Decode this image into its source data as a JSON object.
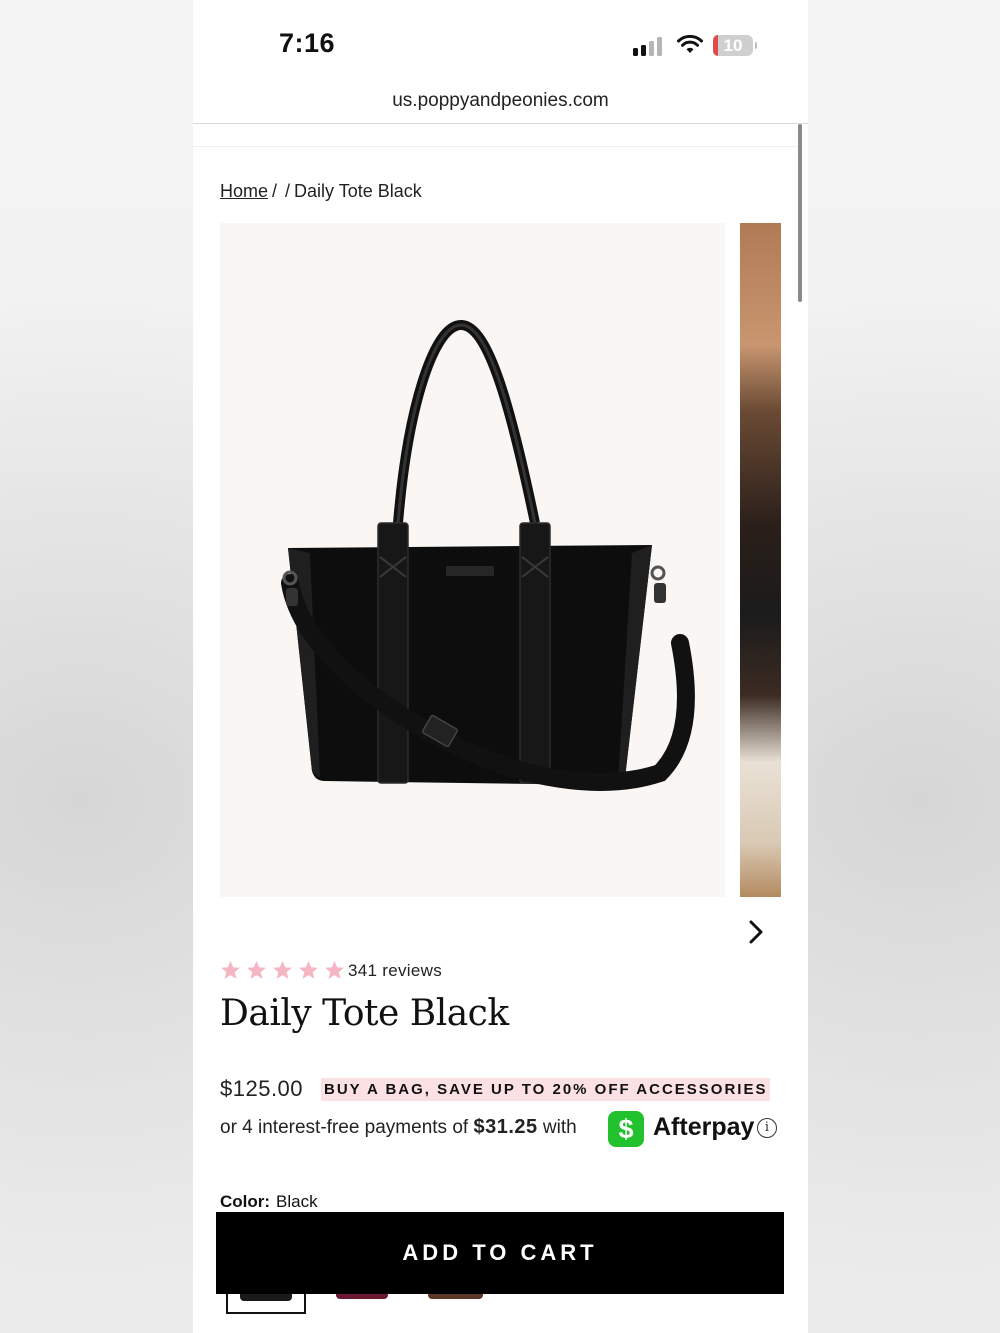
{
  "status_bar": {
    "time": "7:16",
    "battery": "10",
    "icons": [
      "signal-icon",
      "wifi-icon",
      "battery-icon"
    ]
  },
  "browser": {
    "url": "us.poppyandpeonies.com"
  },
  "breadcrumb": {
    "home": "Home",
    "separator": "/",
    "current": "Daily Tote Black"
  },
  "gallery": {
    "main_image": "black-tote-bag-image",
    "next_icon": "chevron-right-icon"
  },
  "product": {
    "rating": 5,
    "rating_max": 5,
    "star_color": "#f3b6c2",
    "reviews": "341 reviews",
    "title": "Daily Tote Black",
    "price": "$125.00",
    "promo": "BUY A BAG, SAVE UP TO 20% OFF ACCESSORIES",
    "promo_bg": "#fbe1e3",
    "installment_prefix": "or 4 interest-free payments of",
    "installment_amount": "$31.25",
    "installment_with": "with",
    "cashapp_symbol": "$",
    "afterpay_label": "Afterpay",
    "info_symbol": "i",
    "color_label": "Color:",
    "color_value": "Black",
    "swatches": [
      "Black",
      "Wine",
      "Brown"
    ]
  },
  "cta": {
    "add_to_cart": "ADD TO CART"
  }
}
